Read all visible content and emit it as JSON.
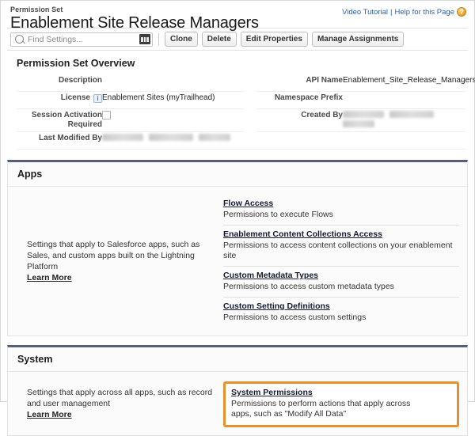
{
  "header": {
    "eyebrow": "Permission Set",
    "title": "Enablement Site Release Managers",
    "video_tutorial": "Video Tutorial",
    "separator": "|",
    "help_link": "Help for this Page",
    "help_icon_glyph": "?"
  },
  "toolbar": {
    "search_placeholder": "Find Settings...",
    "search_value": "",
    "buttons": [
      {
        "label": "Clone"
      },
      {
        "label": "Delete"
      },
      {
        "label": "Edit Properties"
      },
      {
        "label": "Manage Assignments"
      }
    ]
  },
  "overview": {
    "title": "Permission Set Overview",
    "rows": [
      {
        "left_label": "Description",
        "left_value": "",
        "right_label": "API Name",
        "right_value": "Enablement_Site_Release_Managers"
      },
      {
        "left_label": "License",
        "left_value": "Enablement Sites (myTrailhead)",
        "right_label": "Namespace Prefix",
        "right_value": ""
      },
      {
        "left_label": "Session Activation Required",
        "left_value": "",
        "right_label": "Created By",
        "right_value": ""
      },
      {
        "left_label": "Last Modified By",
        "left_value": "",
        "right_label": "",
        "right_value": ""
      }
    ]
  },
  "apps_section": {
    "title": "Apps",
    "description": "Settings that apply to Salesforce apps, such as Sales, and custom apps built on the Lightning Platform",
    "learn_more": "Learn More",
    "links": [
      {
        "label": "Flow Access",
        "description": "Permissions to execute Flows"
      },
      {
        "label": "Enablement Content Collections Access",
        "description": "Permissions to access content collections on your enablement site"
      },
      {
        "label": "Custom Metadata Types",
        "description": "Permissions to access custom metadata types"
      },
      {
        "label": "Custom Setting Definitions",
        "description": "Permissions to access custom settings"
      }
    ]
  },
  "system_section": {
    "title": "System",
    "description": "Settings that apply across all apps, such as record and user management",
    "learn_more": "Learn More",
    "links": [
      {
        "label": "System Permissions",
        "description": "Permissions to perform actions that apply across apps, such as \"Modify All Data\"",
        "highlighted": true
      }
    ]
  },
  "colors": {
    "highlight_border": "#E8912C",
    "section_top_border": "#565F7A",
    "link_blue": "#2A62B5",
    "help_icon": "#EDA42B"
  }
}
